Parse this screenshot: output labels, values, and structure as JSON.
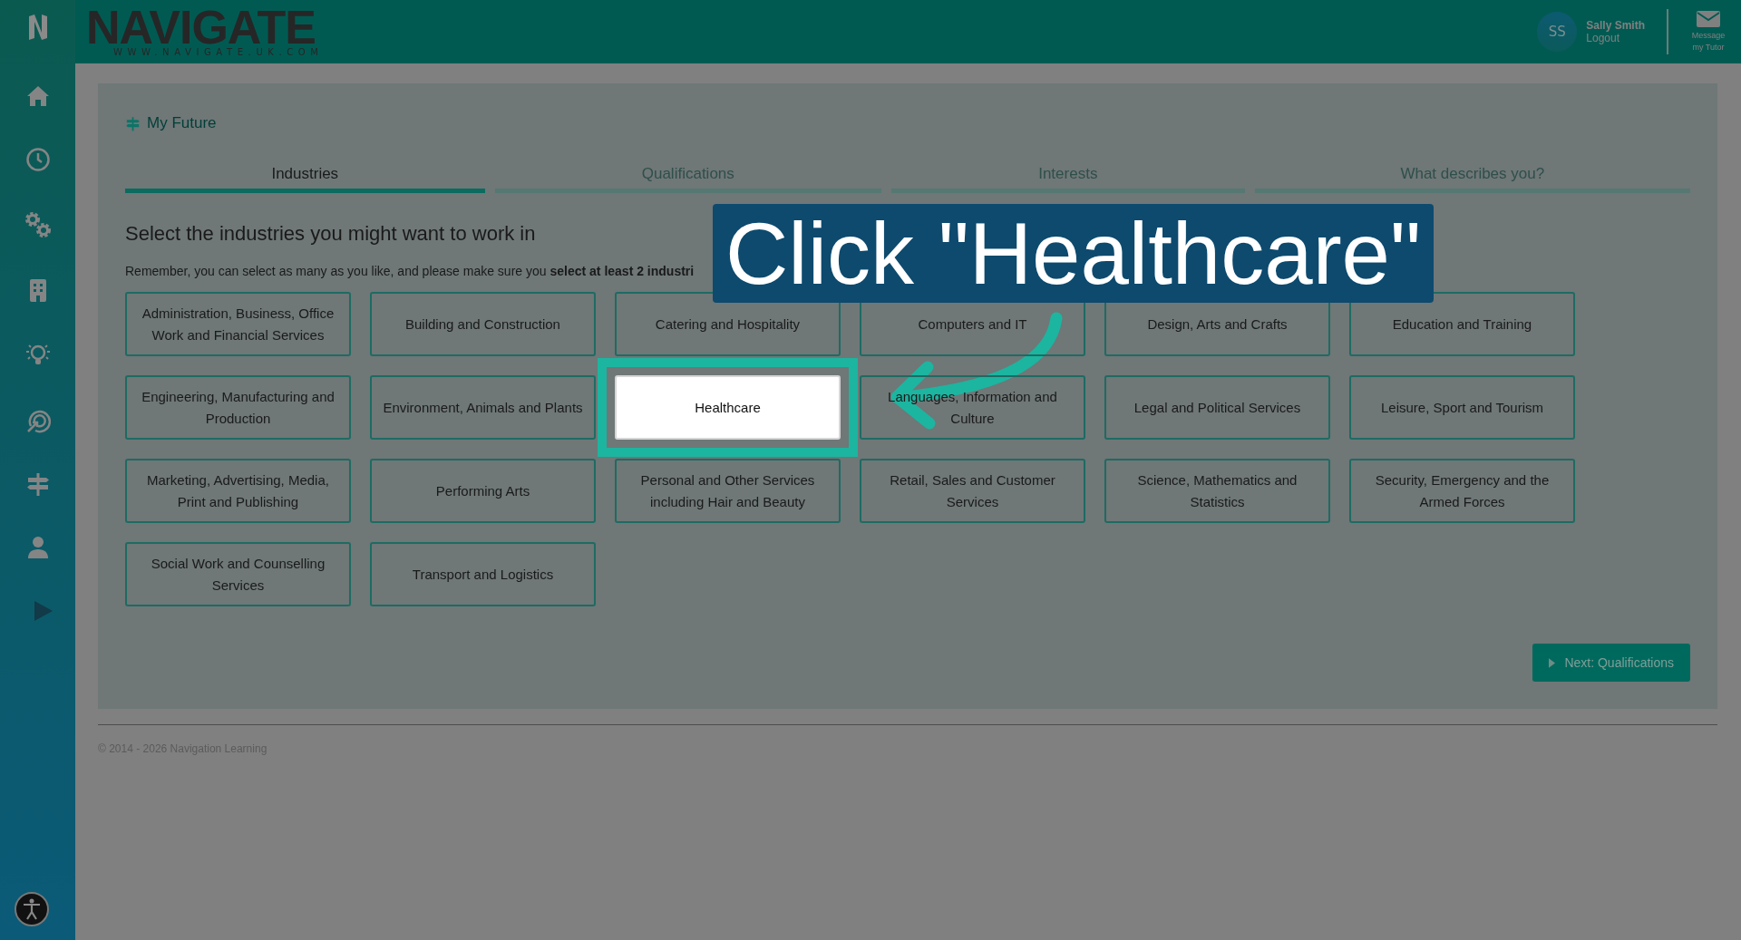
{
  "header": {
    "logo": {
      "wordmark": "NAVIGATE",
      "tagline": "WWW.NAVIGATE.UK.COM"
    },
    "user": {
      "initials": "SS",
      "name": "Sally Smith",
      "logout": "Logout"
    },
    "message_button": "Message my Tutor"
  },
  "sidebar": {
    "items": [
      {
        "kind": "home"
      },
      {
        "kind": "clock"
      },
      {
        "kind": "gears"
      },
      {
        "kind": "building"
      },
      {
        "kind": "bulb"
      },
      {
        "kind": "target"
      },
      {
        "kind": "signpost"
      },
      {
        "kind": "person"
      },
      {
        "kind": "play"
      }
    ]
  },
  "page": {
    "breadcrumb": "My Future",
    "tabs": [
      {
        "label": "Industries",
        "selected": true
      },
      {
        "label": "Qualifications",
        "selected": false
      },
      {
        "label": "Interests",
        "selected": false
      },
      {
        "label": "What describes you?",
        "selected": false
      }
    ],
    "heading": "Select the industries you might want to work in",
    "instruction": "Remember, you can select as many as you like, and please make sure you **select at least 2 industri**",
    "industries": [
      {
        "label": "Administration, Business, Office Work and Financial Services",
        "highlighted": false
      },
      {
        "label": "Building and Construction",
        "highlighted": false
      },
      {
        "label": "Catering and Hospitality",
        "highlighted": false
      },
      {
        "label": "Computers and IT",
        "highlighted": false
      },
      {
        "label": "Design, Arts and Crafts",
        "highlighted": false
      },
      {
        "label": "Education and Training",
        "highlighted": false
      },
      {
        "label": "Engineering, Manufacturing and Production",
        "highlighted": false
      },
      {
        "label": "Environment, Animals and Plants",
        "highlighted": false
      },
      {
        "label": "Healthcare",
        "highlighted": true
      },
      {
        "label": "Languages, Information and Culture",
        "highlighted": false
      },
      {
        "label": "Legal and Political Services",
        "highlighted": false
      },
      {
        "label": "Leisure, Sport and Tourism",
        "highlighted": false
      },
      {
        "label": "Marketing, Advertising, Media, Print and Publishing",
        "highlighted": false
      },
      {
        "label": "Performing Arts",
        "highlighted": false
      },
      {
        "label": "Personal and Other Services including Hair and Beauty",
        "highlighted": false
      },
      {
        "label": "Retail, Sales and Customer Services",
        "highlighted": false
      },
      {
        "label": "Science, Mathematics and Statistics",
        "highlighted": false
      },
      {
        "label": "Security, Emergency and the Armed Forces",
        "highlighted": false
      },
      {
        "label": "Social Work and Counselling Services",
        "highlighted": false
      },
      {
        "label": "Transport and Logistics",
        "highlighted": false
      }
    ],
    "next_button": "Next: Qualifications"
  },
  "footer": "© 2014 - 2026 Navigation Learning",
  "callout": {
    "text": "Click \"Healthcare\""
  }
}
